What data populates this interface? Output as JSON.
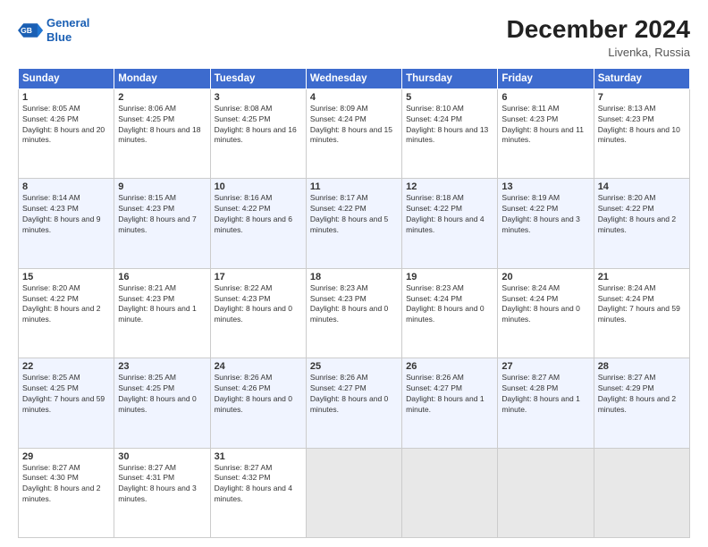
{
  "header": {
    "logo_line1": "General",
    "logo_line2": "Blue",
    "month": "December 2024",
    "location": "Livenka, Russia"
  },
  "days_of_week": [
    "Sunday",
    "Monday",
    "Tuesday",
    "Wednesday",
    "Thursday",
    "Friday",
    "Saturday"
  ],
  "weeks": [
    [
      {
        "day": 1,
        "sunrise": "8:05 AM",
        "sunset": "4:26 PM",
        "daylight": "8 hours and 20 minutes"
      },
      {
        "day": 2,
        "sunrise": "8:06 AM",
        "sunset": "4:25 PM",
        "daylight": "8 hours and 18 minutes"
      },
      {
        "day": 3,
        "sunrise": "8:08 AM",
        "sunset": "4:25 PM",
        "daylight": "8 hours and 16 minutes"
      },
      {
        "day": 4,
        "sunrise": "8:09 AM",
        "sunset": "4:24 PM",
        "daylight": "8 hours and 15 minutes"
      },
      {
        "day": 5,
        "sunrise": "8:10 AM",
        "sunset": "4:24 PM",
        "daylight": "8 hours and 13 minutes"
      },
      {
        "day": 6,
        "sunrise": "8:11 AM",
        "sunset": "4:23 PM",
        "daylight": "8 hours and 11 minutes"
      },
      {
        "day": 7,
        "sunrise": "8:13 AM",
        "sunset": "4:23 PM",
        "daylight": "8 hours and 10 minutes"
      }
    ],
    [
      {
        "day": 8,
        "sunrise": "8:14 AM",
        "sunset": "4:23 PM",
        "daylight": "8 hours and 9 minutes"
      },
      {
        "day": 9,
        "sunrise": "8:15 AM",
        "sunset": "4:23 PM",
        "daylight": "8 hours and 7 minutes"
      },
      {
        "day": 10,
        "sunrise": "8:16 AM",
        "sunset": "4:22 PM",
        "daylight": "8 hours and 6 minutes"
      },
      {
        "day": 11,
        "sunrise": "8:17 AM",
        "sunset": "4:22 PM",
        "daylight": "8 hours and 5 minutes"
      },
      {
        "day": 12,
        "sunrise": "8:18 AM",
        "sunset": "4:22 PM",
        "daylight": "8 hours and 4 minutes"
      },
      {
        "day": 13,
        "sunrise": "8:19 AM",
        "sunset": "4:22 PM",
        "daylight": "8 hours and 3 minutes"
      },
      {
        "day": 14,
        "sunrise": "8:20 AM",
        "sunset": "4:22 PM",
        "daylight": "8 hours and 2 minutes"
      }
    ],
    [
      {
        "day": 15,
        "sunrise": "8:20 AM",
        "sunset": "4:22 PM",
        "daylight": "8 hours and 2 minutes"
      },
      {
        "day": 16,
        "sunrise": "8:21 AM",
        "sunset": "4:23 PM",
        "daylight": "8 hours and 1 minute"
      },
      {
        "day": 17,
        "sunrise": "8:22 AM",
        "sunset": "4:23 PM",
        "daylight": "8 hours and 0 minutes"
      },
      {
        "day": 18,
        "sunrise": "8:23 AM",
        "sunset": "4:23 PM",
        "daylight": "8 hours and 0 minutes"
      },
      {
        "day": 19,
        "sunrise": "8:23 AM",
        "sunset": "4:24 PM",
        "daylight": "8 hours and 0 minutes"
      },
      {
        "day": 20,
        "sunrise": "8:24 AM",
        "sunset": "4:24 PM",
        "daylight": "8 hours and 0 minutes"
      },
      {
        "day": 21,
        "sunrise": "8:24 AM",
        "sunset": "4:24 PM",
        "daylight": "7 hours and 59 minutes"
      }
    ],
    [
      {
        "day": 22,
        "sunrise": "8:25 AM",
        "sunset": "4:25 PM",
        "daylight": "7 hours and 59 minutes"
      },
      {
        "day": 23,
        "sunrise": "8:25 AM",
        "sunset": "4:25 PM",
        "daylight": "8 hours and 0 minutes"
      },
      {
        "day": 24,
        "sunrise": "8:26 AM",
        "sunset": "4:26 PM",
        "daylight": "8 hours and 0 minutes"
      },
      {
        "day": 25,
        "sunrise": "8:26 AM",
        "sunset": "4:27 PM",
        "daylight": "8 hours and 0 minutes"
      },
      {
        "day": 26,
        "sunrise": "8:26 AM",
        "sunset": "4:27 PM",
        "daylight": "8 hours and 1 minute"
      },
      {
        "day": 27,
        "sunrise": "8:27 AM",
        "sunset": "4:28 PM",
        "daylight": "8 hours and 1 minute"
      },
      {
        "day": 28,
        "sunrise": "8:27 AM",
        "sunset": "4:29 PM",
        "daylight": "8 hours and 2 minutes"
      }
    ],
    [
      {
        "day": 29,
        "sunrise": "8:27 AM",
        "sunset": "4:30 PM",
        "daylight": "8 hours and 2 minutes"
      },
      {
        "day": 30,
        "sunrise": "8:27 AM",
        "sunset": "4:31 PM",
        "daylight": "8 hours and 3 minutes"
      },
      {
        "day": 31,
        "sunrise": "8:27 AM",
        "sunset": "4:32 PM",
        "daylight": "8 hours and 4 minutes"
      },
      null,
      null,
      null,
      null
    ]
  ]
}
